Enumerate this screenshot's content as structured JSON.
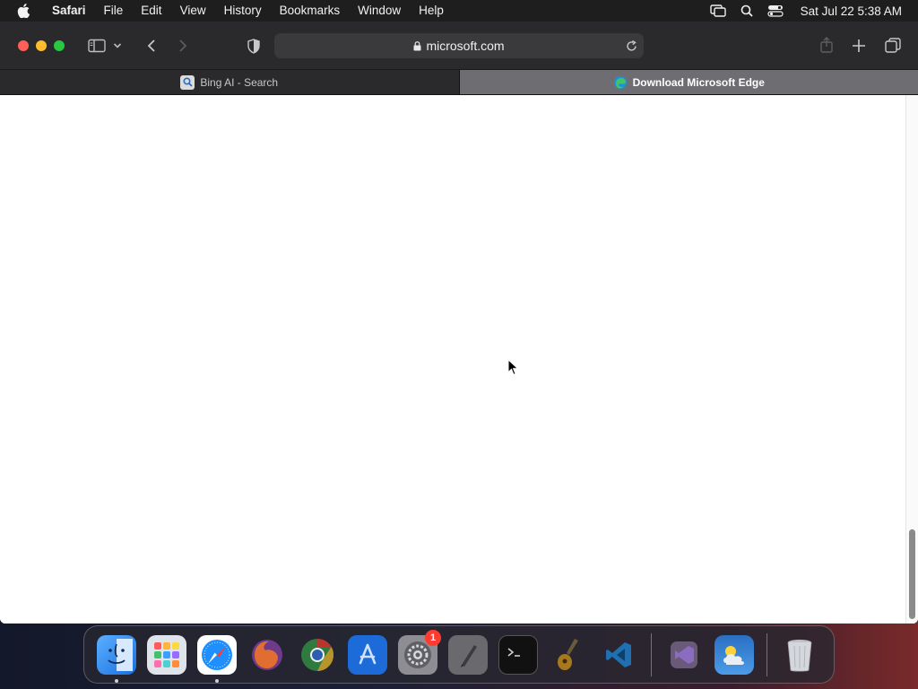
{
  "menubar": {
    "app_name": "Safari",
    "items": [
      "File",
      "Edit",
      "View",
      "History",
      "Bookmarks",
      "Window",
      "Help"
    ],
    "clock": "Sat Jul 22  5:38 AM"
  },
  "browser": {
    "address": "microsoft.com",
    "tabs": [
      {
        "label": "Bing AI - Search",
        "active": false
      },
      {
        "label": "Download Microsoft Edge",
        "active": true
      }
    ]
  },
  "dock": {
    "settings_badge": "1",
    "apps": [
      "finder-icon",
      "launchpad-icon",
      "safari-icon",
      "firefox-icon",
      "chrome-icon",
      "app-store-icon",
      "system-settings-icon",
      "script-editor-icon",
      "terminal-icon",
      "garageband-icon",
      "vscode-icon",
      "visual-studio-icon",
      "weather-icon",
      "trash-icon"
    ]
  },
  "colors": {
    "menubar_bg": "#1e1e1e",
    "toolbar_bg": "#2a2a2c",
    "active_tab_bg": "#6e6e72",
    "close": "#fe5f57",
    "minimize": "#febc2e",
    "maximize": "#28c840"
  }
}
